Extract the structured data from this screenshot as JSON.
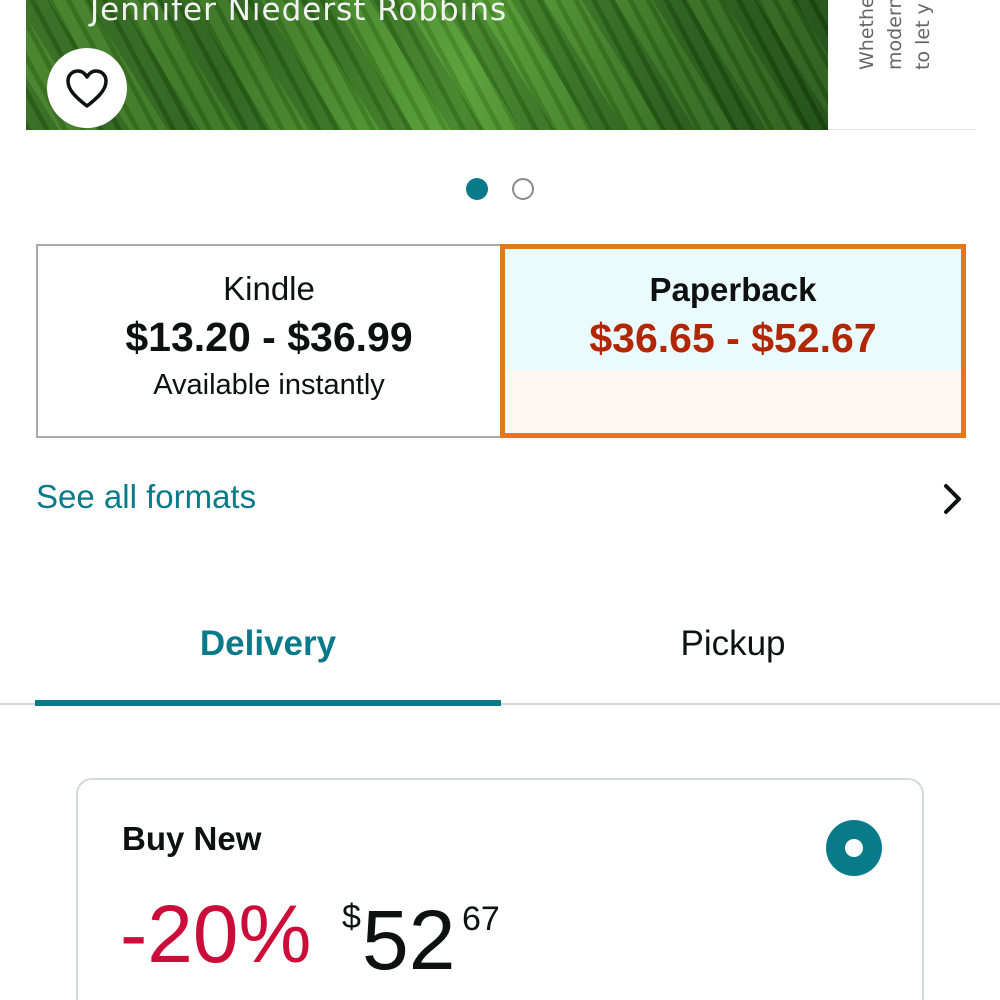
{
  "hero": {
    "author": "Jennifer Niederst Robbins",
    "side_text": [
      "Whethe",
      "modern",
      "to let y"
    ],
    "wishlist_icon": "heart-outline-icon"
  },
  "carousel": {
    "total": 2,
    "active": 1
  },
  "formats": {
    "kindle": {
      "name": "Kindle",
      "price": "$13.20 - $36.99",
      "availability": "Available instantly"
    },
    "paperback": {
      "name": "Paperback",
      "price": "$36.65 - $52.67",
      "selected": true
    }
  },
  "see_all_formats": "See all formats",
  "tabs": {
    "delivery": "Delivery",
    "pickup": "Pickup",
    "active": "Delivery"
  },
  "buy_new": {
    "title": "Buy New",
    "discount": "-20%",
    "price_symbol": "$",
    "price_whole": "52",
    "price_fraction": "67"
  },
  "colors": {
    "accent": "#087a8a",
    "selected_border": "#e47911",
    "price_red": "#b12704",
    "discount_red": "#cc0c39"
  }
}
